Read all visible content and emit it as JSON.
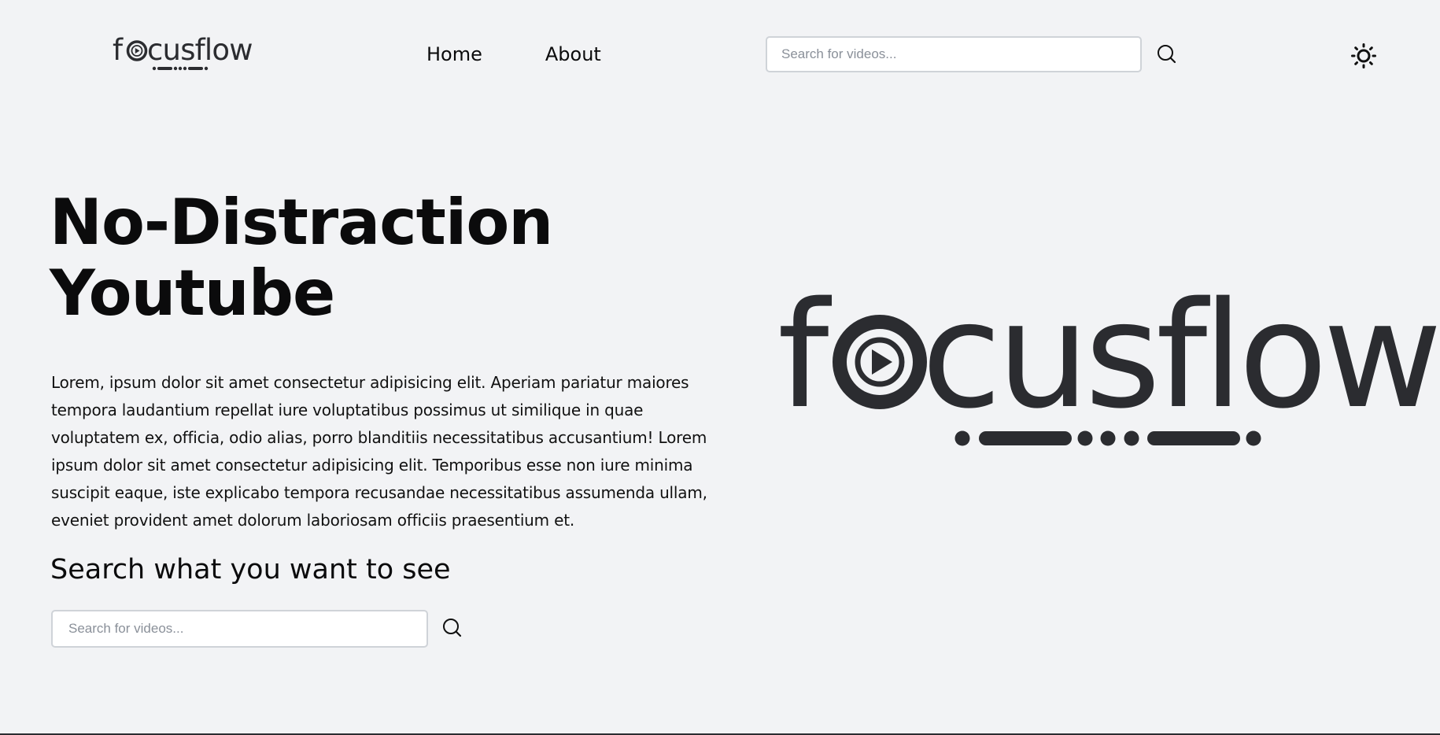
{
  "brand": {
    "name": "focusflow",
    "logo_color": "#2b2c30"
  },
  "nav": {
    "items": [
      {
        "label": "Home"
      },
      {
        "label": "About"
      }
    ]
  },
  "header_search": {
    "placeholder": "Search for videos...",
    "value": "",
    "icon": "search-icon"
  },
  "theme_toggle": {
    "icon": "sun-icon"
  },
  "hero": {
    "title_line1": "No-Distraction",
    "title_line2": "Youtube",
    "body": "Lorem, ipsum dolor sit amet consectetur adipisicing elit. Aperiam pariatur maiores tempora laudantium repellat iure voluptatibus possimus ut similique in quae voluptatem ex, officia, odio alias, porro blanditiis necessitatibus accusantium! Lorem ipsum dolor sit amet consectetur adipisicing elit. Temporibus esse non iure minima suscipit eaque, iste explicabo tempora recusandae necessitatibus assumenda ullam, eveniet provident amet dolorum laboriosam officiis praesentium et.",
    "search_heading": "Search what you want to see"
  },
  "main_search": {
    "placeholder": "Search for videos...",
    "value": "",
    "icon": "search-icon"
  },
  "colors": {
    "background": "#f2f3f5",
    "text": "#0b0b0c",
    "input_border": "#cfd3d8",
    "placeholder": "#8a9099"
  }
}
